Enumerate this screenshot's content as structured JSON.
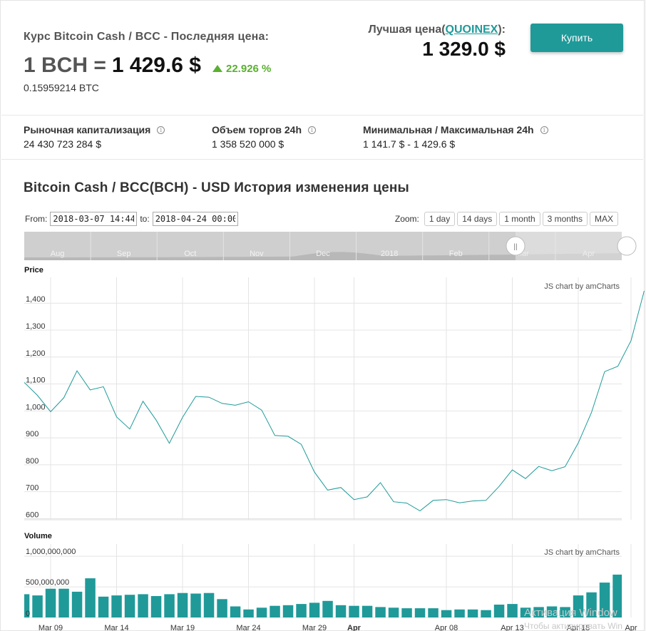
{
  "header": {
    "rate_title": "Курс Bitcoin Cash / BCC - Последняя цена:",
    "price_bch": "1 BCH =",
    "price_usd": "1 429.6 $",
    "change": "22.926 %",
    "price_btc": "0.15959214 BTC",
    "best_label_prefix": "Лучшая цена(",
    "best_exchange": "QUOINEX",
    "best_label_suffix": "):",
    "best_price": "1 329.0 $",
    "buy_label": "Купить"
  },
  "stats": [
    {
      "label": "Рыночная капитализация",
      "value": "24 430 723 284 $"
    },
    {
      "label": "Объем торгов 24h",
      "value": "1 358 520 000 $"
    },
    {
      "label": "Минимальная / Максимальная 24h",
      "value": "1 141.7 $ - 1 429.6 $"
    }
  ],
  "history": {
    "title": "Bitcoin Cash / BCC(BCH) - USD История изменения цены",
    "from_label": "From:",
    "from_value": "2018-03-07 14:44",
    "to_label": "to:",
    "to_value": "2018-04-24 00:00",
    "zoom_label": "Zoom:",
    "zoom_buttons": [
      "1 day",
      "14 days",
      "1 month",
      "3 months",
      "MAX"
    ]
  },
  "watermark": {
    "line1": "Активация Window",
    "line2": "Чтобы активировать Win"
  },
  "colors": {
    "accent": "#1f9a99",
    "positive": "#5ab030"
  },
  "icons": {
    "change": "triangle-up-icon",
    "info": "info-icon"
  },
  "chart_data": {
    "type": "line",
    "price_title": "Price",
    "volume_title": "Volume",
    "credit": "JS chart by amCharts",
    "price_ylim": [
      580,
      1480
    ],
    "price_ticks": [
      600,
      700,
      800,
      900,
      1000,
      1100,
      1200,
      1300,
      1400
    ],
    "price_tick_labels": [
      "600",
      "700",
      "800",
      "900",
      "1,000",
      "1,100",
      "1,200",
      "1,300",
      "1,400"
    ],
    "volume_ylim": [
      0,
      1200000000
    ],
    "volume_ticks": [
      0,
      500000000,
      1000000000
    ],
    "volume_tick_labels": [
      "0",
      "500,000,000",
      "1,000,000,000"
    ],
    "x_labels": [
      {
        "day": 2,
        "label": "Mar 09",
        "bold": false
      },
      {
        "day": 7,
        "label": "Mar 14",
        "bold": false
      },
      {
        "day": 12,
        "label": "Mar 19",
        "bold": false
      },
      {
        "day": 17,
        "label": "Mar 24",
        "bold": false
      },
      {
        "day": 22,
        "label": "Mar 29",
        "bold": false
      },
      {
        "day": 25,
        "label": "Apr",
        "bold": true
      },
      {
        "day": 32,
        "label": "Apr 08",
        "bold": false
      },
      {
        "day": 37,
        "label": "Apr 13",
        "bold": false
      },
      {
        "day": 42,
        "label": "Apr 18",
        "bold": false
      },
      {
        "day": 46,
        "label": "Apr",
        "bold": false
      }
    ],
    "x_grid_days": [
      2,
      7,
      12,
      17,
      22,
      25,
      32,
      37,
      42,
      46
    ],
    "price": [
      1090,
      1042,
      981,
      1033,
      1133,
      1062,
      1074,
      962,
      917,
      1020,
      950,
      864,
      960,
      1038,
      1035,
      1012,
      1005,
      1018,
      987,
      893,
      890,
      860,
      757,
      690,
      700,
      655,
      665,
      718,
      647,
      642,
      613,
      652,
      655,
      643,
      650,
      652,
      704,
      765,
      733,
      778,
      762,
      777,
      865,
      978,
      1130,
      1150,
      1245,
      1430
    ],
    "volume": [
      380,
      360,
      470,
      470,
      420,
      640,
      340,
      360,
      370,
      380,
      350,
      380,
      400,
      390,
      400,
      300,
      180,
      130,
      160,
      190,
      200,
      220,
      240,
      270,
      200,
      190,
      190,
      170,
      160,
      150,
      150,
      150,
      120,
      130,
      130,
      120,
      210,
      220,
      160,
      170,
      180,
      170,
      360,
      410,
      570,
      700,
      580,
      1170
    ]
  },
  "navigator": {
    "labels": [
      "Aug",
      "Sep",
      "Oct",
      "Nov",
      "Dec",
      "2018",
      "Feb",
      "Mar",
      "Apr"
    ]
  }
}
